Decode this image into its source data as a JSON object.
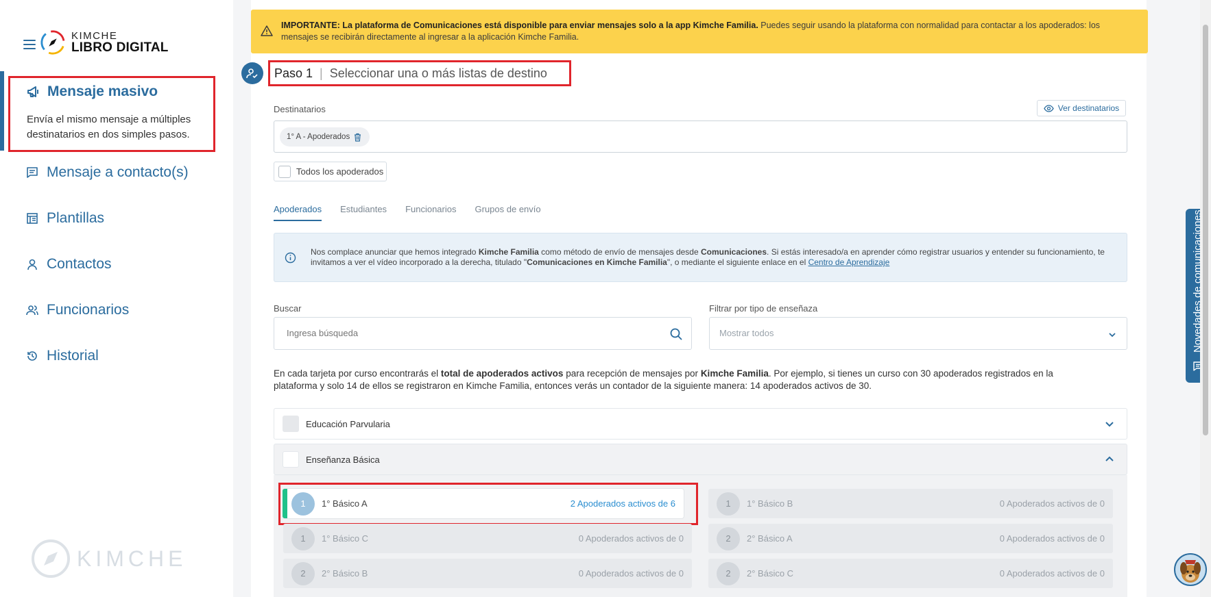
{
  "brand": {
    "line1": "KIMCHE",
    "line2": "LIBRO DIGITAL",
    "footer": "KIMCHE"
  },
  "sidebar": {
    "active": {
      "title": "Mensaje masivo",
      "description": "Envía el mismo mensaje a múltiples destinatarios en dos simples pasos."
    },
    "items": [
      {
        "label": "Mensaje a contacto(s)",
        "icon": "chat-icon"
      },
      {
        "label": "Plantillas",
        "icon": "template-icon"
      },
      {
        "label": "Contactos",
        "icon": "user-icon"
      },
      {
        "label": "Funcionarios",
        "icon": "users-icon"
      },
      {
        "label": "Historial",
        "icon": "history-icon"
      }
    ]
  },
  "banner": {
    "bold": "IMPORTANTE: La plataforma de Comunicaciones está disponible para enviar mensajes solo a la app Kimche Familia.",
    "text": " Puedes seguir usando la plataforma con normalidad para contactar a los apoderados: los mensajes se recibirán directamente al ingresar a la aplicación Kimche Familia."
  },
  "step": {
    "label": "Paso 1",
    "separator": "|",
    "instruction": "Seleccionar una o más listas de destino"
  },
  "recipients": {
    "label": "Destinatarios",
    "view_button": "Ver destinatarios",
    "chips": [
      "1° A - Apoderados"
    ],
    "all_label": "Todos los apoderados"
  },
  "tabs": [
    "Apoderados",
    "Estudiantes",
    "Funcionarios",
    "Grupos de envío"
  ],
  "info": {
    "t1": "Nos complace anunciar que hemos integrado ",
    "b1": "Kimche Familia",
    "t2": " como método de envío de mensajes desde ",
    "b2": "Comunicaciones",
    "t3": ". Si estás interesado/a en aprender cómo registrar usuarios y entender su funcionamiento, te invitamos a ver el vídeo incorporado a la derecha, titulado \"",
    "b3": "Comunicaciones en Kimche Familia",
    "t4": "\", o mediante el siguiente enlace en el ",
    "link": "Centro de Aprendizaje"
  },
  "search": {
    "label": "Buscar",
    "placeholder": "Ingresa búsqueda"
  },
  "filter": {
    "label": "Filtrar por tipo de enseñaza",
    "value": "Mostrar todos"
  },
  "paragraph": {
    "t1": "En cada tarjeta por curso encontrarás el ",
    "b1": "total de apoderados activos",
    "t2": " para recepción de mensajes por ",
    "b2": "Kimche Familia",
    "t3": ". Por ejemplo, si tienes un curso con 30 apoderados registrados en la plataforma y solo 14 de ellos se registraron en Kimche Familia, entonces verás un contador de la siguiente manera: 14 apoderados activos de 30."
  },
  "sections": [
    {
      "label": "Educación Parvularia",
      "expanded": false
    },
    {
      "label": "Enseñanza Básica",
      "expanded": true
    }
  ],
  "courses": [
    {
      "num": "1",
      "name": "1° Básico A",
      "count": "2 Apoderados activos de 6",
      "selected": true
    },
    {
      "num": "1",
      "name": "1° Básico B",
      "count": "0 Apoderados activos de 0",
      "selected": false
    },
    {
      "num": "1",
      "name": "1° Básico C",
      "count": "0 Apoderados activos de 0",
      "selected": false
    },
    {
      "num": "2",
      "name": "2° Básico A",
      "count": "0 Apoderados activos de 0",
      "selected": false
    },
    {
      "num": "2",
      "name": "2° Básico B",
      "count": "0 Apoderados activos de 0",
      "selected": false
    },
    {
      "num": "2",
      "name": "2° Básico C",
      "count": "0 Apoderados activos de 0",
      "selected": false
    }
  ],
  "side_tab": "Novedades de comunicaciones",
  "colors": {
    "primary": "#2b6c9e",
    "highlight": "#e0252c",
    "banner": "#fcd24c",
    "active_bar": "#1fc28a"
  }
}
